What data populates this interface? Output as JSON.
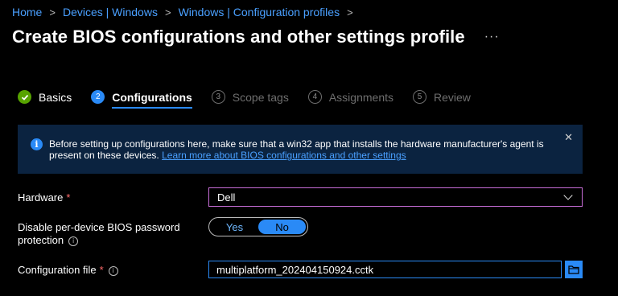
{
  "breadcrumb": {
    "items": [
      "Home",
      "Devices | Windows",
      "Windows | Configuration profiles"
    ],
    "separator": ">"
  },
  "header": {
    "title": "Create BIOS configurations and other settings profile",
    "more_label": "···"
  },
  "wizard": {
    "steps": [
      {
        "label": "Basics",
        "number": "",
        "state": "done"
      },
      {
        "label": "Configurations",
        "number": "2",
        "state": "active"
      },
      {
        "label": "Scope tags",
        "number": "3",
        "state": "pending"
      },
      {
        "label": "Assignments",
        "number": "4",
        "state": "pending"
      },
      {
        "label": "Review",
        "number": "5",
        "state": "pending"
      }
    ]
  },
  "info": {
    "text": "Before setting up configurations here, make sure that a win32 app that installs the hardware manufacturer's agent is present on these devices.",
    "link": "Learn more about BIOS configurations and other settings",
    "close": "✕",
    "icon": "i"
  },
  "form": {
    "hardware": {
      "label": "Hardware",
      "required": "*",
      "value": "Dell"
    },
    "password": {
      "label_line1": "Disable per-device BIOS password",
      "label_line2": "protection",
      "options": [
        "Yes",
        "No"
      ],
      "selected": "No"
    },
    "config_file": {
      "label": "Configuration file",
      "required": "*",
      "value": "multiplatform_202404150924.cctk"
    }
  },
  "colors": {
    "accent": "#2a8af6",
    "link": "#4aa0ff",
    "success": "#57a300",
    "banner": "#0b2340",
    "focus_border": "#c86dd7"
  }
}
